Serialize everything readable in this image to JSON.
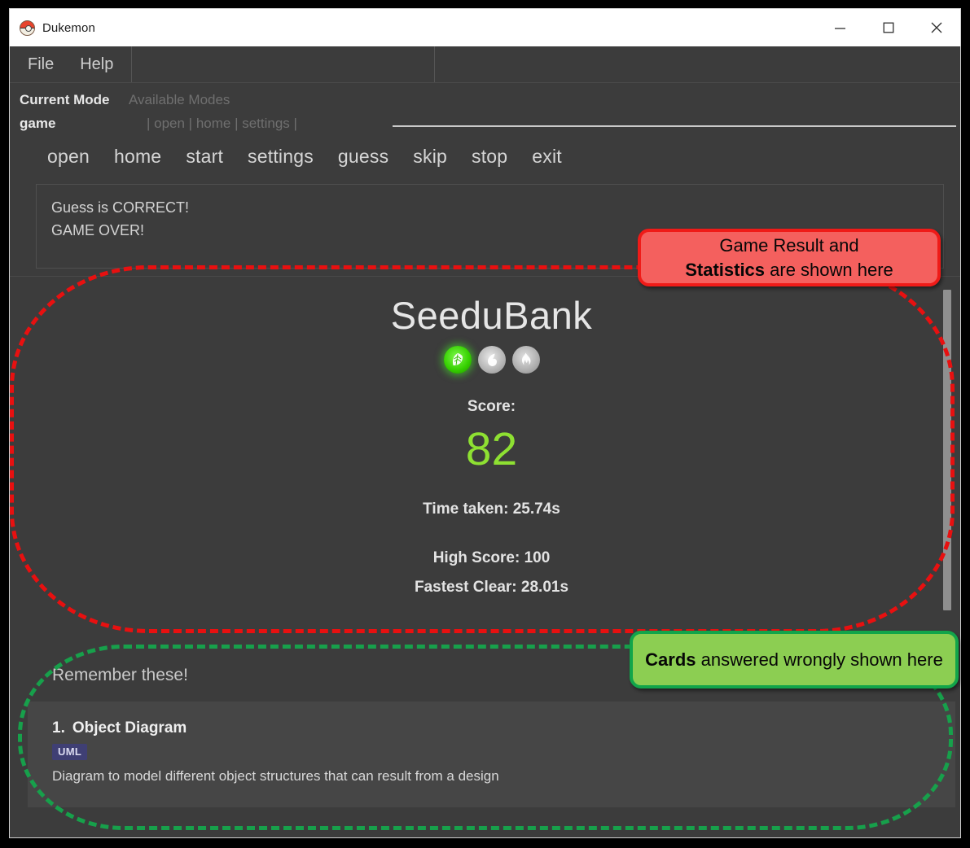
{
  "window": {
    "title": "Dukemon",
    "app_icon": "pokeball-icon",
    "controls": {
      "minimize": "minimize-icon",
      "maximize": "maximize-icon",
      "close": "close-icon"
    }
  },
  "menubar": {
    "items": [
      {
        "label": "File"
      },
      {
        "label": "Help"
      }
    ]
  },
  "mode_bar": {
    "current_mode_label": "Current Mode",
    "available_modes_label": "Available Modes",
    "current_mode_value": "game",
    "available_modes_value": "| open | home | settings |",
    "command_input_value": ""
  },
  "nav": {
    "items": [
      {
        "label": "open"
      },
      {
        "label": "home"
      },
      {
        "label": "start"
      },
      {
        "label": "settings"
      },
      {
        "label": "guess"
      },
      {
        "label": "skip"
      },
      {
        "label": "stop"
      },
      {
        "label": "exit"
      }
    ]
  },
  "result_box": {
    "lines": [
      "Guess is CORRECT!",
      "GAME OVER!"
    ]
  },
  "result_panel": {
    "brand": "SeeduBank",
    "elements": [
      {
        "name": "grass-element-icon",
        "state": "active",
        "color": "#35d000"
      },
      {
        "name": "water-element-icon",
        "state": "inactive",
        "color": "#b4b4b4"
      },
      {
        "name": "fire-element-icon",
        "state": "inactive",
        "color": "#aeaeae"
      }
    ],
    "score_label": "Score:",
    "score_value": "82",
    "score_color": "#8ee032",
    "time_taken": "Time taken: 25.74s",
    "high_score": "High Score: 100",
    "fastest_clear": "Fastest Clear: 28.01s"
  },
  "remember": {
    "title": "Remember these!",
    "cards": [
      {
        "index": "1.",
        "title": "Object Diagram",
        "tag": "UML",
        "tag_color": "#3f3f74",
        "description": "Diagram to model different object structures that can result from a design"
      }
    ]
  },
  "annotations": [
    {
      "id": "result-callout",
      "color": "#ef1b18",
      "lines": [
        {
          "plain": "Game Result and",
          "bold": ""
        },
        {
          "bold": "Statistics",
          "plain": " are shown here"
        }
      ]
    },
    {
      "id": "cards-callout",
      "color": "#12a54a",
      "lines": [
        {
          "bold": "Cards",
          "plain": " answered wrongly shown here"
        }
      ]
    }
  ]
}
